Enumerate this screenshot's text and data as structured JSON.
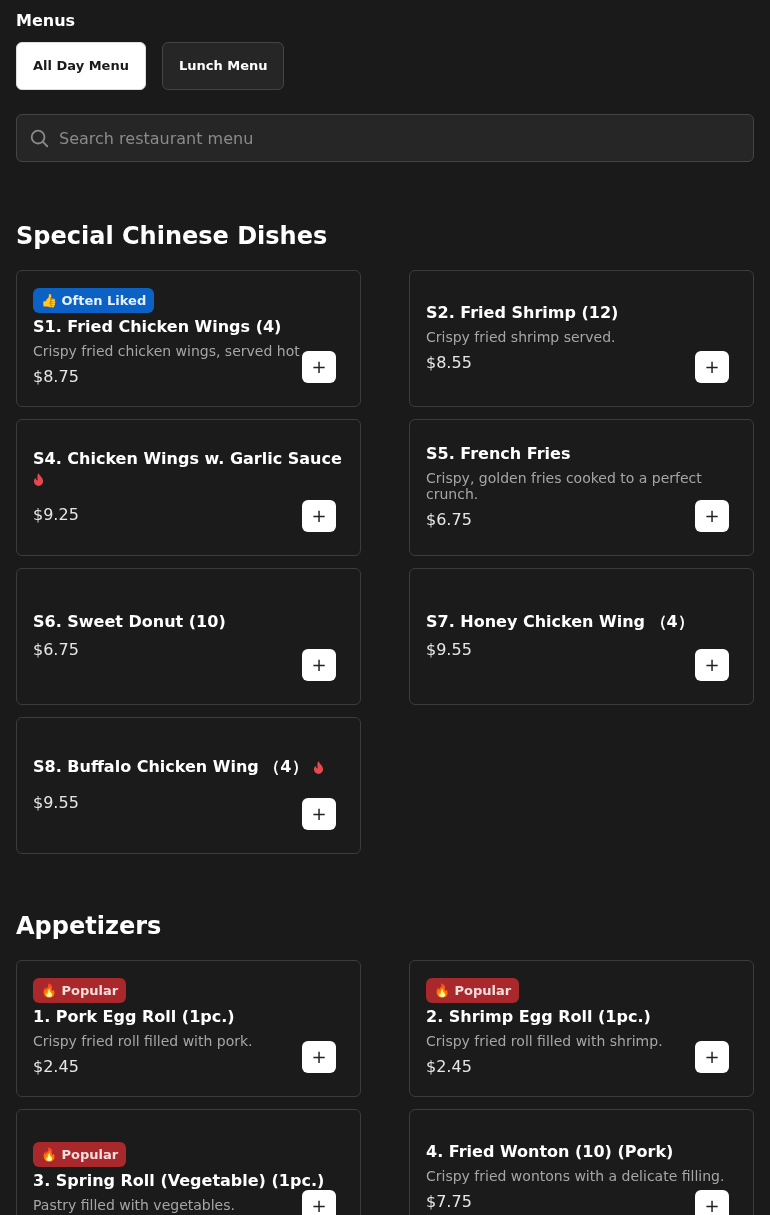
{
  "menus": {
    "title": "Menus",
    "tabs": [
      {
        "label": "All Day Menu",
        "selected": true
      },
      {
        "label": "Lunch Menu",
        "selected": false
      }
    ]
  },
  "search": {
    "placeholder": "Search restaurant menu"
  },
  "sections": [
    {
      "title": "Special Chinese Dishes",
      "items": [
        {
          "badge": {
            "kind": "liked",
            "icon": "👍",
            "label": "Often Liked"
          },
          "name": "S1. Fried Chicken Wings (4)",
          "spicy": false,
          "description": "Crispy fried chicken wings, served hot",
          "price": "$8.75",
          "add": "+"
        },
        {
          "name": "S2. Fried Shrimp (12)",
          "spicy": false,
          "description": "Crispy fried shrimp served.",
          "price": "$8.55",
          "add": "+"
        },
        {
          "name": "S4. Chicken Wings w. Garlic Sauce",
          "spicy": true,
          "price": "$9.25",
          "add": "+"
        },
        {
          "name": "S5. French Fries",
          "spicy": false,
          "description": "Crispy, golden fries cooked to a perfect crunch.",
          "price": "$6.75",
          "add": "+"
        },
        {
          "name": "S6. Sweet Donut (10)",
          "spicy": false,
          "price": "$6.75",
          "add": "+"
        },
        {
          "name": "S7. Honey Chicken Wing （4）",
          "spicy": false,
          "price": "$9.55",
          "add": "+"
        },
        {
          "name": "S8. Buffalo Chicken Wing （4）",
          "spicy": true,
          "price": "$9.55",
          "add": "+"
        }
      ]
    },
    {
      "title": "Appetizers",
      "items": [
        {
          "badge": {
            "kind": "popular",
            "icon": "🔥",
            "label": "Popular"
          },
          "name": "1. Pork Egg Roll (1pc.)",
          "spicy": false,
          "description": "Crispy fried roll filled with pork.",
          "price": "$2.45",
          "add": "+"
        },
        {
          "badge": {
            "kind": "popular",
            "icon": "🔥",
            "label": "Popular"
          },
          "name": "2. Shrimp Egg Roll (1pc.)",
          "spicy": false,
          "description": "Crispy fried roll filled with shrimp.",
          "price": "$2.45",
          "add": "+"
        },
        {
          "badge": {
            "kind": "popular",
            "icon": "🔥",
            "label": "Popular"
          },
          "name": "3. Spring Roll (Vegetable) (1pc.)",
          "spicy": false,
          "description": "Pastry filled with vegetables.",
          "add": "+"
        },
        {
          "name": "4. Fried Wonton (10) (Pork)",
          "spicy": false,
          "description": "Crispy fried wontons with a delicate filling.",
          "price": "$7.75",
          "add": "+"
        }
      ]
    }
  ]
}
